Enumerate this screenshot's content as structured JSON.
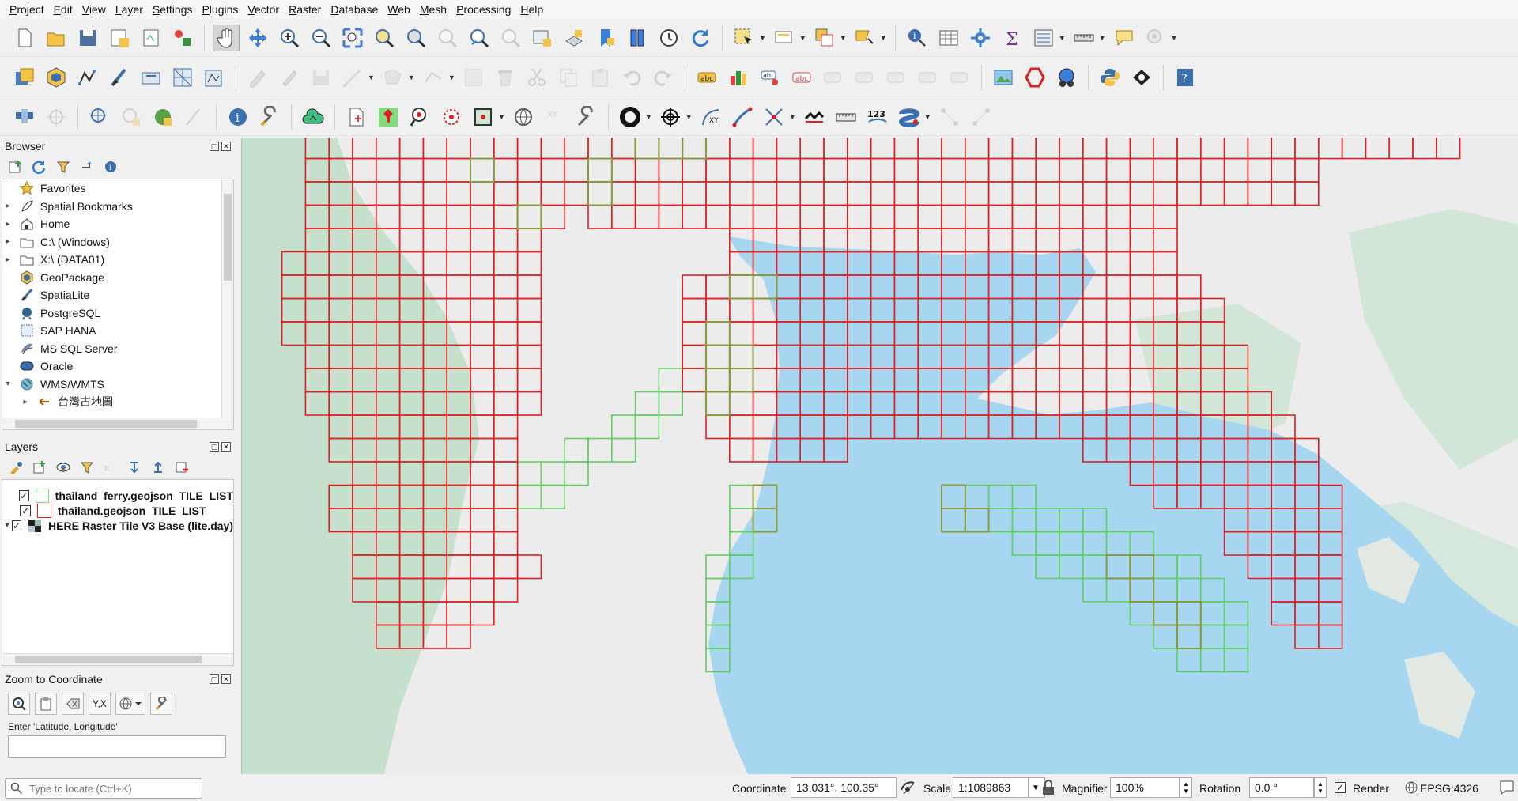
{
  "menu": [
    "Project",
    "Edit",
    "View",
    "Layer",
    "Settings",
    "Plugins",
    "Vector",
    "Raster",
    "Database",
    "Web",
    "Mesh",
    "Processing",
    "Help"
  ],
  "browser": {
    "title": "Browser",
    "items": [
      {
        "label": "Favorites",
        "icon": "star-icon",
        "expand": ""
      },
      {
        "label": "Spatial Bookmarks",
        "icon": "bookmark-icon",
        "expand": "▸"
      },
      {
        "label": "Home",
        "icon": "home-icon",
        "expand": "▸"
      },
      {
        "label": "C:\\ (Windows)",
        "icon": "drive-icon",
        "expand": "▸"
      },
      {
        "label": "X:\\ (DATA01)",
        "icon": "drive-icon",
        "expand": "▸"
      },
      {
        "label": "GeoPackage",
        "icon": "geopackage-icon",
        "expand": ""
      },
      {
        "label": "SpatiaLite",
        "icon": "spatialite-icon",
        "expand": ""
      },
      {
        "label": "PostgreSQL",
        "icon": "postgresql-icon",
        "expand": ""
      },
      {
        "label": "SAP HANA",
        "icon": "hana-icon",
        "expand": ""
      },
      {
        "label": "MS SQL Server",
        "icon": "mssql-icon",
        "expand": ""
      },
      {
        "label": "Oracle",
        "icon": "oracle-icon",
        "expand": ""
      },
      {
        "label": "WMS/WMTS",
        "icon": "wms-icon",
        "expand": "▾"
      },
      {
        "label": "台灣古地圖",
        "icon": "wms-layer-icon",
        "expand": "▸"
      }
    ]
  },
  "layers": {
    "title": "Layers",
    "items": [
      {
        "label": "thailand_ferry.geojson_TILE_LIST",
        "swatch": "#7fdc7f",
        "checked": "✓",
        "underline": true
      },
      {
        "label": "thailand.geojson_TILE_LIST",
        "swatch": "#e02020",
        "checked": "✓",
        "underline": false
      },
      {
        "label": "HERE Raster Tile V3 Base (lite.day)",
        "swatch": "raster",
        "checked": "✓",
        "underline": false
      }
    ]
  },
  "zoom": {
    "title": "Zoom to Coordinate",
    "hint": "Enter 'Latitude, Longitude'",
    "yx_label": "Y,X",
    "value": ""
  },
  "status": {
    "locate_placeholder": "Type to locate (Ctrl+K)",
    "coordinate_label": "Coordinate",
    "coordinate_value": "13.031°, 100.35°",
    "scale_label": "Scale",
    "scale_value": "1:1089863",
    "magnifier_label": "Magnifier",
    "magnifier_value": "100%",
    "rotation_label": "Rotation",
    "rotation_value": "0.0 °",
    "render_label": "Render",
    "render_checked": "✓",
    "crs": "EPSG:4326"
  },
  "colors": {
    "land_tile": "#e02020",
    "ferry_tile": "#5fd05f",
    "overlap_tile": "#8a9a3a",
    "water": "#a7d6f0",
    "land": "#ececec",
    "forest": "#b9dcc4"
  }
}
